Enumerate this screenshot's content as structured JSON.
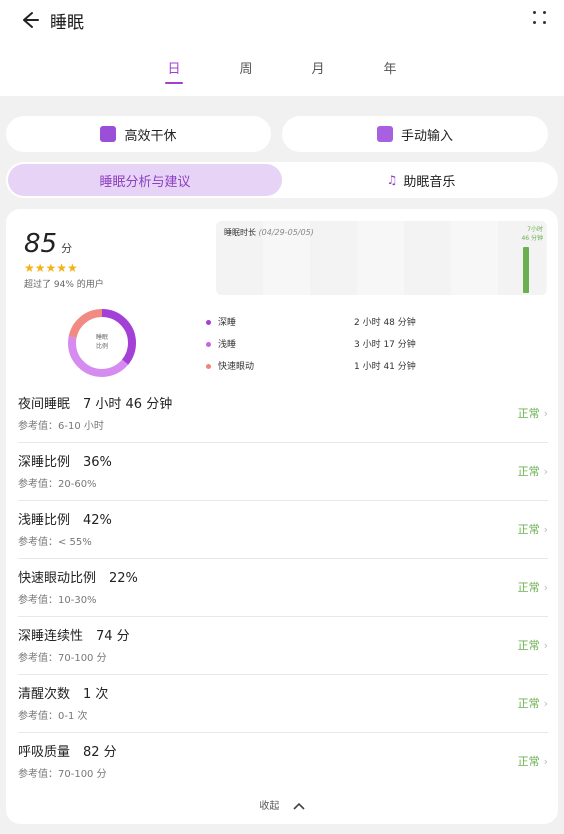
{
  "header": {
    "title": "睡眠"
  },
  "tabs": [
    {
      "label": "日",
      "active": true
    },
    {
      "label": "周",
      "active": false
    },
    {
      "label": "月",
      "active": false
    },
    {
      "label": "年",
      "active": false
    }
  ],
  "actions": {
    "efficient_label": "高效干休",
    "manual_label": "手动输入"
  },
  "segments": {
    "analysis_label": "睡眠分析与建议",
    "music_label": "助眠音乐"
  },
  "summary": {
    "score": "85",
    "score_unit": "分",
    "stars": "★★★★★",
    "star_rating": 4.5,
    "beat_text": "超过了 94% 的用户"
  },
  "mini_chart": {
    "title": "睡眠时长",
    "range": "(04/29-05/05)",
    "latest_label_line1": "7小时",
    "latest_label_line2": "46 分钟",
    "bar_fraction": 0.62
  },
  "donut": {
    "center_line1": "睡眠",
    "center_line2": "比例",
    "slices": [
      {
        "name": "deep",
        "value": 36,
        "color": "#a340d6"
      },
      {
        "name": "light",
        "value": 42,
        "color": "#d58bf0"
      },
      {
        "name": "rem",
        "value": 22,
        "color": "#f08a82"
      }
    ]
  },
  "legend": [
    {
      "name": "深睡",
      "value": "2 小时 48 分钟",
      "color": "#a340d6"
    },
    {
      "name": "浅睡",
      "value": "3 小时 17 分钟",
      "color": "#c762e6"
    },
    {
      "name": "快速眼动",
      "value": "1 小时 41 分钟",
      "color": "#f0837a"
    }
  ],
  "rows": [
    {
      "title": "夜间睡眠　7 小时 46 分钟",
      "ref": "参考值：6-10 小时",
      "status": "正常"
    },
    {
      "title": "深睡比例　36%",
      "ref": "参考值：20-60%",
      "status": "正常"
    },
    {
      "title": "浅睡比例　42%",
      "ref": "参考值：< 55%",
      "status": "正常"
    },
    {
      "title": "快速眼动比例　22%",
      "ref": "参考值：10-30%",
      "status": "正常"
    },
    {
      "title": "深睡连续性　74 分",
      "ref": "参考值：70-100 分",
      "status": "正常"
    },
    {
      "title": "清醒次数　1 次",
      "ref": "参考值：0-1 次",
      "status": "正常"
    },
    {
      "title": "呼吸质量　82 分",
      "ref": "参考值：70-100 分",
      "status": "正常"
    }
  ],
  "collapse_label": "收起",
  "colors": {
    "accent": "#a23fd1",
    "ok": "#6ab050",
    "segment_bg": "#e7d3f6"
  }
}
